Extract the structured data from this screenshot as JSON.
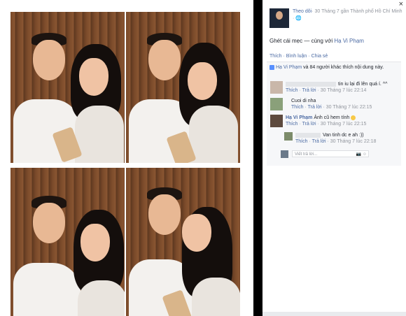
{
  "photos": [
    {
      "label": "photo-1"
    },
    {
      "label": "photo-2"
    },
    {
      "label": "photo-3"
    },
    {
      "label": "photo-4"
    }
  ],
  "panel": {
    "close_label": "×",
    "follow_label": "Theo dõi",
    "post_meta": "· 30 Tháng 7 gần Thành phố Hồ Chí Minh · ",
    "caption_text": "Ghét cái mẹc — cùng với ",
    "caption_tag": "Hạ Vi Phạm",
    "actions": {
      "like": "Thích",
      "comment": "Bình luận",
      "share": "Chia sẻ",
      "sep": " · "
    },
    "likes": {
      "name": "Hạ Vi Phạm",
      "rest": " và 84 người khác thích nội dung này."
    },
    "comments": [
      {
        "text": "tin iu lại đi lên quá í. ^^",
        "like": "Thích",
        "reply": "Trả lời",
        "time": "30 Tháng 7 lúc 22:14"
      },
      {
        "text": "Cuoi di nha",
        "like": "Thích",
        "reply": "Trả lời",
        "time": "30 Tháng 7 lúc 22:15"
      },
      {
        "name": "Hạ Vi Phạm",
        "text": " Ảnh cũ hem tính ",
        "like": "Thích",
        "reply": "Trả lời",
        "time": "30 Tháng 7 lúc 22:15"
      },
      {
        "text": "Van tinh dc e ah :))",
        "like": "Thích",
        "reply": "Trả lời",
        "time": "30 Tháng 7 lúc 22:18"
      }
    ],
    "write_placeholder": "Viết trả lời...",
    "camera_icon": "📷",
    "smiley_icon": "☺"
  }
}
